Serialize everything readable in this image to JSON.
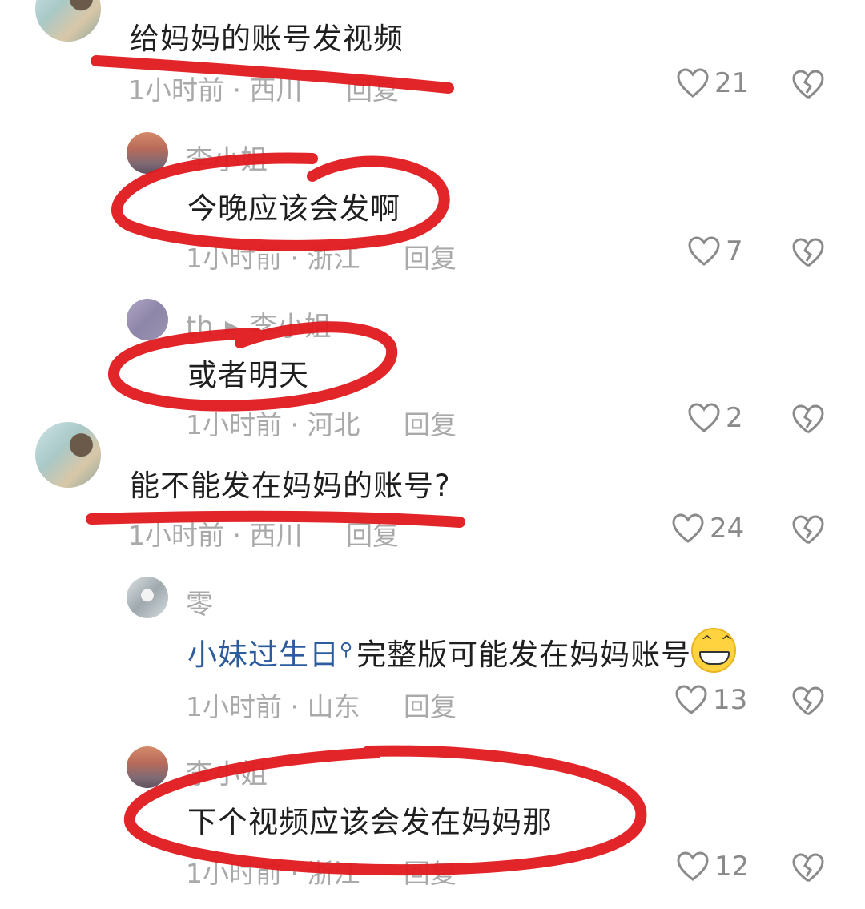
{
  "comments": [
    {
      "text": "给妈妈的账号发视频",
      "time": "1小时前",
      "location": "西川",
      "reply": "回复",
      "likes": "21"
    },
    {
      "username": "李小姐",
      "text": "今晚应该会发啊",
      "time": "1小时前",
      "location": "浙江",
      "reply": "回复",
      "likes": "7"
    },
    {
      "username": "th",
      "reply_to": "李小姐",
      "text": "或者明天",
      "time": "1小时前",
      "location": "河北",
      "reply": "回复",
      "likes": "2"
    },
    {
      "text": "能不能发在妈妈的账号?",
      "time": "1小时前",
      "location": "西川",
      "reply": "回复",
      "likes": "24"
    },
    {
      "username": "零",
      "link_text": "小妹过生日",
      "text": "完整版可能发在妈妈账号",
      "time": "1小时前",
      "location": "山东",
      "reply": "回复",
      "likes": "13"
    },
    {
      "username": "李小姐",
      "text": "下个视频应该会发在妈妈那",
      "time": "1小时前",
      "location": "浙江",
      "reply": "回复",
      "likes": "12"
    }
  ],
  "separator": "·",
  "colors": {
    "annotation_red": "#e0191e",
    "link_blue": "#2d5c9e",
    "meta_gray": "#a9a9a9"
  },
  "icons": {
    "like": "heart-outline-icon",
    "dislike": "broken-heart-icon",
    "search": "search-icon",
    "emoji": "grinning-face-emoji"
  }
}
